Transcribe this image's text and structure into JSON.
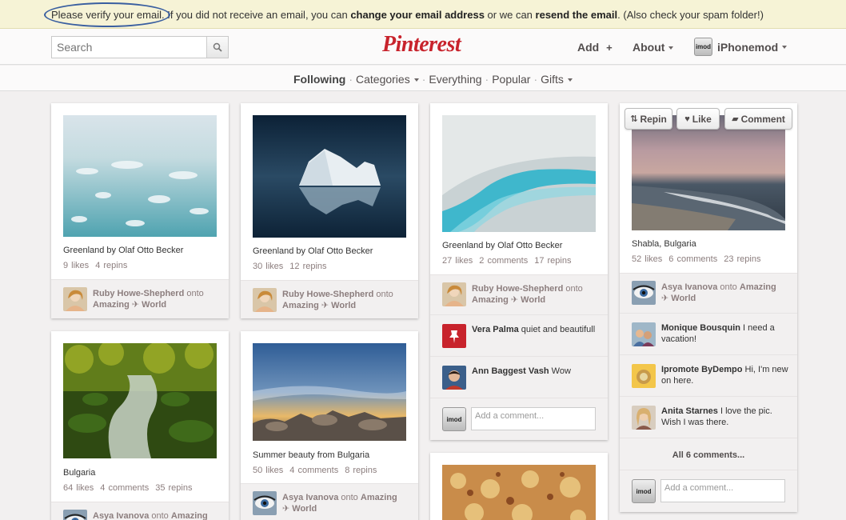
{
  "verify": {
    "part1": "Please verify your email.",
    "part2": " If you did not receive an email, you can ",
    "link1": "change your email address",
    "part3": " or we can ",
    "link2": "resend the email",
    "part4": ". (Also check your spam folder!)"
  },
  "header": {
    "search_placeholder": "Search",
    "logo": "Pinterest",
    "add": "Add",
    "add_plus": "+",
    "about": "About",
    "avatar_text": "imod",
    "user": "iPhonemod"
  },
  "subnav": {
    "items": [
      "Following",
      "Categories",
      "Everything",
      "Popular",
      "Gifts"
    ]
  },
  "actions": {
    "repin": "Repin",
    "like": "Like",
    "comment": "Comment",
    "repin_icon": "⇅",
    "like_icon": "♥",
    "comment_icon": "▰"
  },
  "pins": [
    {
      "desc": "Greenland by Olaf Otto Becker",
      "likes": "9 likes",
      "repins": "4 repins",
      "user": "Ruby Howe-Shepherd",
      "onto": "onto",
      "board": "Amazing ✈ World"
    },
    {
      "desc": "Greenland by Olaf Otto Becker",
      "likes": "30 likes",
      "repins": "12 repins",
      "user": "Ruby Howe-Shepherd",
      "onto": "onto",
      "board": "Amazing ✈ World"
    },
    {
      "desc": "Greenland by Olaf Otto Becker",
      "likes": "27 likes",
      "comments": "2 comments",
      "repins": "17 repins",
      "user": "Ruby Howe-Shepherd",
      "onto": "onto",
      "board": "Amazing ✈ World",
      "c1_user": "Vera Palma",
      "c1_text": "quiet and beautifull",
      "c2_user": "Ann Baggest Vash",
      "c2_text": "Wow",
      "comment_placeholder": "Add a comment..."
    },
    {
      "desc": "Shabla, Bulgaria",
      "likes": "52 likes",
      "comments": "6 comments",
      "repins": "23 repins",
      "user": "Asya Ivanova",
      "onto": "onto",
      "board1": "Amazing",
      "board2": "✈ World",
      "c1_user": "Monique Bousquin",
      "c1_text": "I need a vacation!",
      "c2_user": "Ipromote ByDempo",
      "c2_text": "Hi, I'm new on here.",
      "c3_user": "Anita Starnes",
      "c3_text": "I love the pic. Wish I was there.",
      "all_comments": "All 6 comments...",
      "comment_placeholder": "Add a comment..."
    },
    {
      "desc": "Bulgaria",
      "likes": "64 likes",
      "comments": "4 comments",
      "repins": "35 repins",
      "user": "Asya Ivanova",
      "onto": "onto",
      "board": "Amazing"
    },
    {
      "desc": "Summer beauty from Bulgaria",
      "likes": "50 likes",
      "comments": "4 comments",
      "repins": "8 repins",
      "user": "Asya Ivanova",
      "onto": "onto",
      "board1": "Amazing",
      "board2": "✈ World"
    }
  ],
  "colors": {
    "brand": "#c8232c",
    "verify_bg": "#f6f3d6",
    "oval": "#3a5fa0"
  }
}
